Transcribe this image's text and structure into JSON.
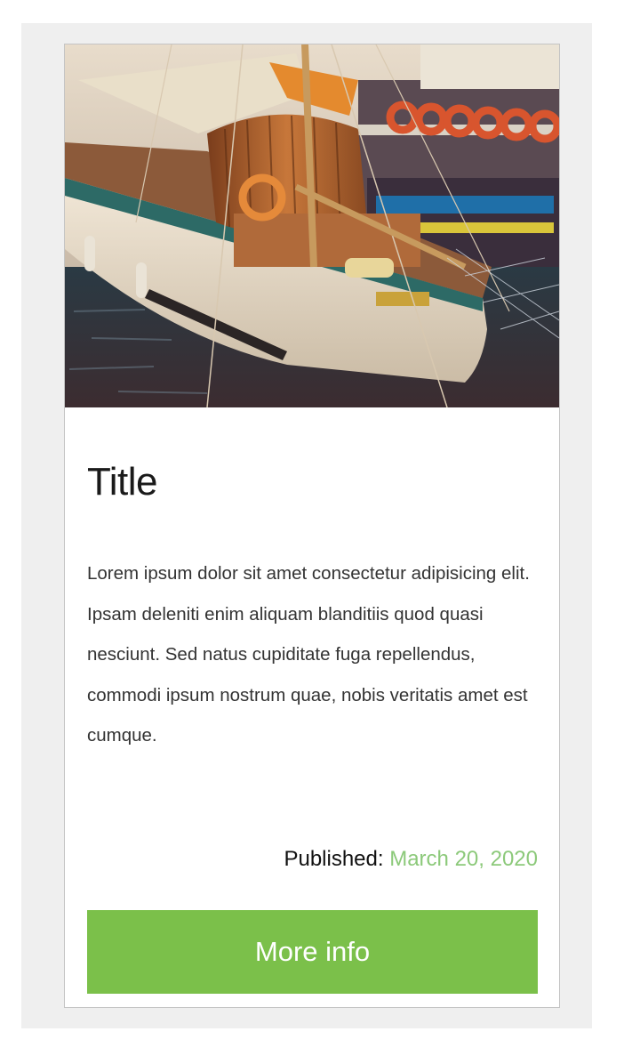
{
  "card": {
    "image_alt": "Sailboat moored at a harbor dock",
    "title": "Title",
    "description": "Lorem ipsum dolor sit amet consectetur adipisicing elit. Ipsam deleniti enim aliquam blanditiis quod quasi nesciunt. Sed natus cupiditate fuga repellendus, commodi ipsum nostrum quae, nobis veritatis amet est cumque.",
    "published_label": "Published:",
    "published_date": "March 20, 2020",
    "button_label": "More info"
  },
  "colors": {
    "accent": "#7bc04a",
    "date_text": "#8cc97a",
    "frame_background": "#efefef",
    "card_border": "#c4c4c4"
  }
}
